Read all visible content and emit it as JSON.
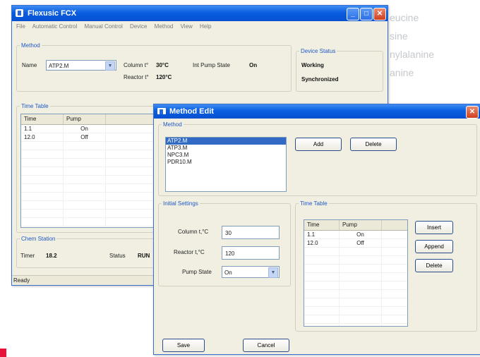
{
  "background_words": [
    "eucine",
    "sine",
    "nylalanine",
    "anine"
  ],
  "main_window": {
    "title": "Flexusic FCX",
    "menu": [
      "File",
      "Automatic Control",
      "Manual Control",
      "Device",
      "Method",
      "View",
      "Help"
    ],
    "method_group": "Method",
    "name_label": "Name",
    "name_value": "ATP2.M",
    "column_label": "Column t°",
    "column_value": "30°C",
    "reactor_label": "Reactor t°",
    "reactor_value": "120°C",
    "pump_state_label": "Int Pump State",
    "pump_state_value": "On",
    "device_status_group": "Device Status",
    "device_status": [
      "Working",
      "Synchronized"
    ],
    "time_table_group": "Time Table",
    "time_table": {
      "headers": [
        "Time",
        "Pump"
      ],
      "rows": [
        [
          "1.1",
          "On"
        ],
        [
          "12.0",
          "Off"
        ]
      ]
    },
    "chem_station_group": "Chem Station",
    "timer_label": "Timer",
    "timer_value": "18.2",
    "status_label": "Status",
    "status_value": "RUN",
    "statusbar": "Ready"
  },
  "method_edit": {
    "title": "Method Edit",
    "method_group": "Method",
    "methods": [
      "ATP2.M",
      "ATP3.M",
      "NPC3.M",
      "PDR10.M"
    ],
    "add_label": "Add",
    "delete_label": "Delete",
    "initial_settings_group": "Initial Settings",
    "column_label": "Column t,°C",
    "column_value": "30",
    "reactor_label": "Reactor t,°C",
    "reactor_value": "120",
    "pump_state_label": "Pump State",
    "pump_state_value": "On",
    "time_table_group": "Time Table",
    "time_table": {
      "headers": [
        "Time",
        "Pump"
      ],
      "rows": [
        [
          "1.1",
          "On"
        ],
        [
          "12.0",
          "Off"
        ]
      ]
    },
    "insert_label": "Insert",
    "append_label": "Append",
    "tt_delete_label": "Delete",
    "save_label": "Save",
    "cancel_label": "Cancel"
  },
  "colors": {
    "titlebar": "#0a5ee0",
    "selection": "#316ac5",
    "group_title": "#1f58c8",
    "red_mark": "#e8113a"
  }
}
